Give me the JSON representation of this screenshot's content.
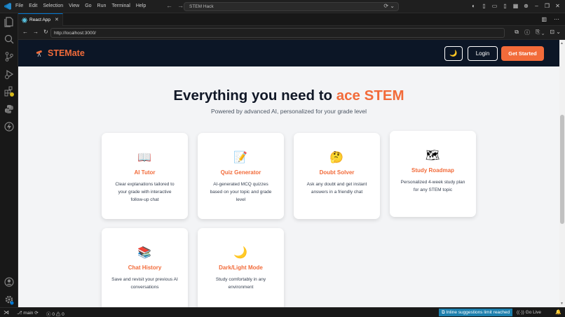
{
  "window": {
    "menu": [
      "File",
      "Edit",
      "Selection",
      "View",
      "Go",
      "Run",
      "Terminal",
      "Help"
    ],
    "search_text": "STEM Hack"
  },
  "tab": {
    "label": "React App",
    "close": "✕"
  },
  "browser": {
    "url": "http://localhost:3000/"
  },
  "site": {
    "brand": "STEMate",
    "theme_toggle_icon": "moon-icon",
    "login_label": "Login",
    "cta_label": "Get Started",
    "hero_title_prefix": "Everything you need to ",
    "hero_title_accent": "ace STEM",
    "hero_subtitle": "Powered by advanced AI, personalized for your grade level",
    "accent_color": "#f26b3a",
    "header_color": "#0c1626"
  },
  "features": [
    {
      "icon": "book-icon",
      "glyph": "📖",
      "title": "AI Tutor",
      "desc": "Clear explanations tailored to your grade with interactive follow-up chat"
    },
    {
      "icon": "memo-icon",
      "glyph": "📝",
      "title": "Quiz Generator",
      "desc": "AI-generated MCQ quizzes based on your topic and grade level"
    },
    {
      "icon": "thinking-face-icon",
      "glyph": "🤔",
      "title": "Doubt Solver",
      "desc": "Ask any doubt and get instant answers in a friendly chat"
    },
    {
      "icon": "map-icon",
      "glyph": "🗺",
      "title": "Study Roadmap",
      "desc": "Personalized 4-week study plan for any STEM topic"
    },
    {
      "icon": "books-icon",
      "glyph": "📚",
      "title": "Chat History",
      "desc": "Save and revisit your previous AI conversations"
    },
    {
      "icon": "crescent-moon-icon",
      "glyph": "🌙",
      "title": "Dark/Light Mode",
      "desc": "Study comfortably in any environment"
    }
  ],
  "statusbar": {
    "branch": "main",
    "errors": "0",
    "warnings": "0",
    "inline": "Inline suggestions limit reached",
    "golive": "Go Live"
  }
}
